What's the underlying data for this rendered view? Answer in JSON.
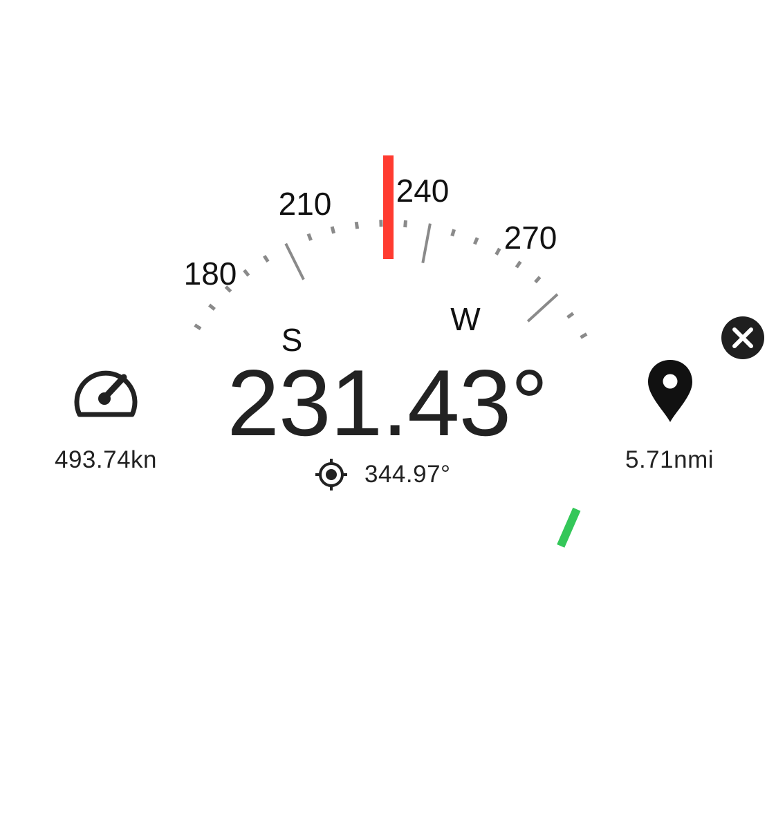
{
  "compass": {
    "heading": "231.43°",
    "heading_deg": 231.43,
    "target_bearing_deg": 344.97,
    "scale_labels": [
      "180",
      "210",
      "240",
      "270"
    ],
    "cardinal_labels": [
      "S",
      "W"
    ],
    "tick_color": "#8a8a8a",
    "heading_marker_color": "#ff3b30",
    "target_marker_color": "#34c759"
  },
  "target": {
    "icon": "crosshair-target-icon",
    "bearing": "344.97°"
  },
  "speed": {
    "icon": "speedometer-icon",
    "value": "493.74kn"
  },
  "distance": {
    "icon": "map-pin-icon",
    "value": "5.71nmi"
  },
  "close_button": {
    "icon": "close-icon"
  }
}
